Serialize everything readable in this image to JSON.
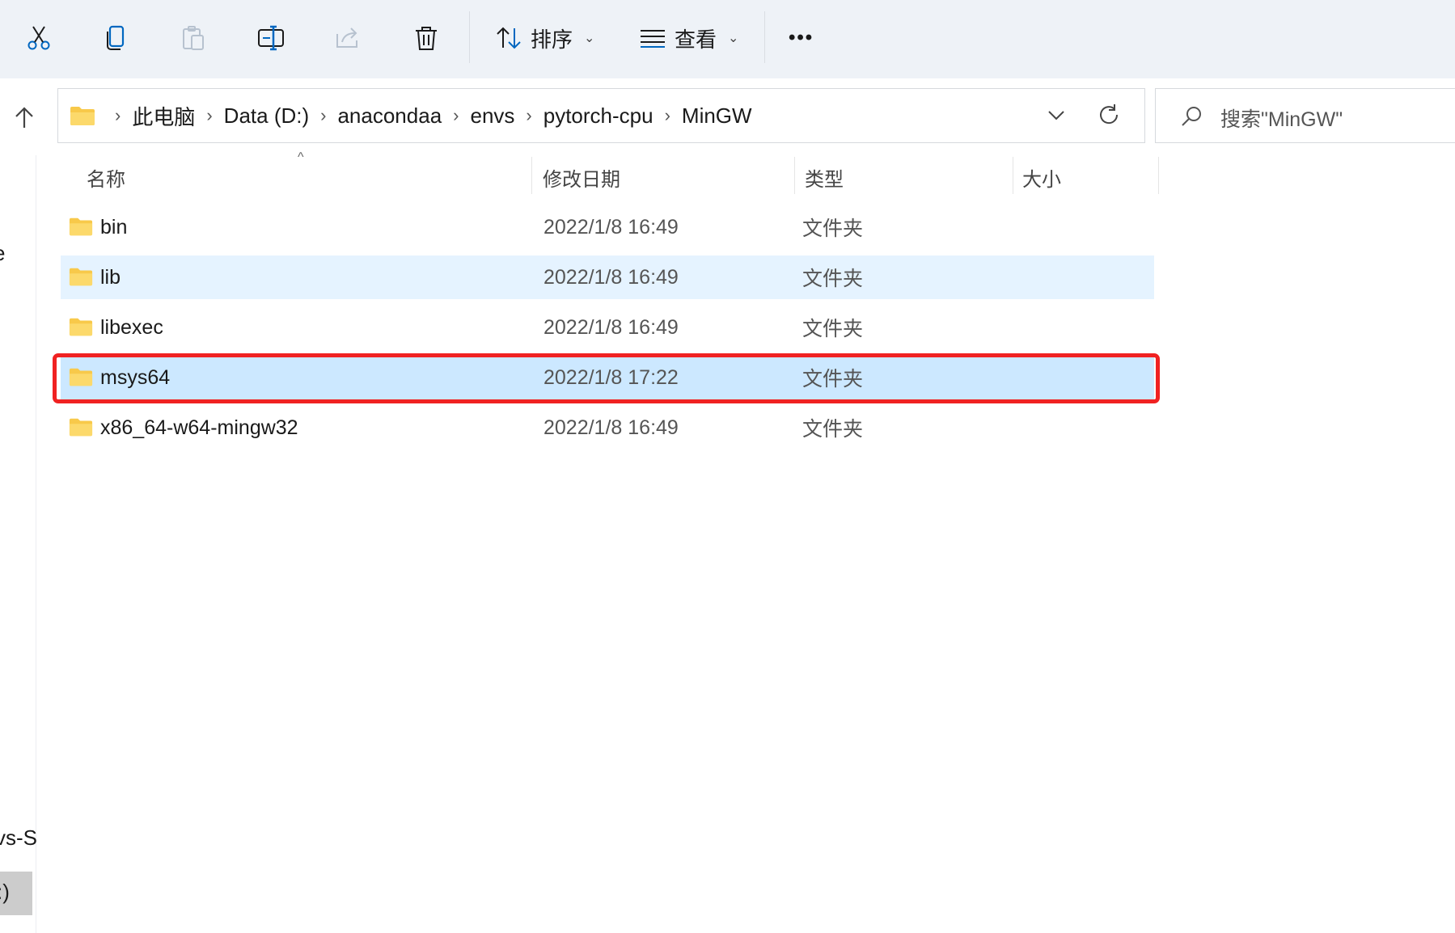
{
  "toolbar": {
    "buttons": [
      {
        "name": "cut",
        "icon": "scissors-icon"
      },
      {
        "name": "copy",
        "icon": "copy-icon"
      },
      {
        "name": "paste",
        "icon": "paste-icon"
      },
      {
        "name": "rename",
        "icon": "rename-icon"
      },
      {
        "name": "share",
        "icon": "share-icon"
      },
      {
        "name": "delete",
        "icon": "trash-icon"
      }
    ],
    "sort_label": "排序",
    "view_label": "查看",
    "more_label": "•••"
  },
  "breadcrumb": [
    "此电脑",
    "Data (D:)",
    "anacondaa",
    "envs",
    "pytorch-cpu",
    "MinGW"
  ],
  "search": {
    "placeholder": "搜索\"MinGW\""
  },
  "columns": {
    "name": "名称",
    "date": "修改日期",
    "type": "类型",
    "size": "大小"
  },
  "files": [
    {
      "name": "bin",
      "date": "2022/1/8 16:49",
      "type": "文件夹",
      "state": "normal"
    },
    {
      "name": "lib",
      "date": "2022/1/8 16:49",
      "type": "文件夹",
      "state": "hover"
    },
    {
      "name": "libexec",
      "date": "2022/1/8 16:49",
      "type": "文件夹",
      "state": "normal"
    },
    {
      "name": "msys64",
      "date": "2022/1/8 17:22",
      "type": "文件夹",
      "state": "selected",
      "highlighted": true
    },
    {
      "name": "x86_64-w64-mingw32",
      "date": "2022/1/8 16:49",
      "type": "文件夹",
      "state": "normal"
    }
  ],
  "left_pane": {
    "text_top": "e",
    "text_mid": "vs-S",
    "text_bottom": ":)"
  },
  "colors": {
    "accent": "#0067c0",
    "highlight_border": "#f02222",
    "selected_row": "#cce8ff",
    "hover_row": "#e5f3ff",
    "folder": "#f8c94a"
  }
}
